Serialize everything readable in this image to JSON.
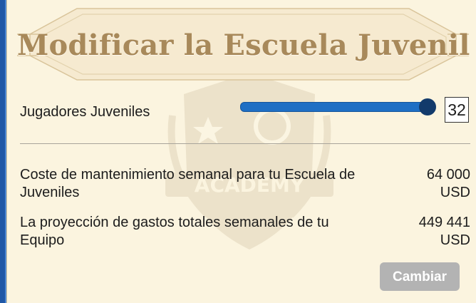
{
  "title": "Modificar la Escuela Juvenil",
  "crest": {
    "text": "ACADEMY",
    "icon": "academy-crest-icon"
  },
  "slider": {
    "label": "Jugadores Juveniles",
    "value": "32",
    "fill_fraction": 1.0
  },
  "costs": [
    {
      "label": "Coste de mantenimiento semanal para tu Escuela de Juveniles",
      "amount": "64 000",
      "currency": "USD"
    },
    {
      "label": "La proyección de gastos totales semanales de tu Equipo",
      "amount": "449 441",
      "currency": "USD"
    }
  ],
  "button": {
    "label": "Cambiar",
    "enabled": false
  },
  "colors": {
    "title": "#a8895a",
    "slider_fill": "#1f6fc4",
    "slider_thumb": "#123a6b",
    "button_disabled": "#b3b3b3",
    "panel": "#fbf4df",
    "edge": "#1f57a6"
  }
}
